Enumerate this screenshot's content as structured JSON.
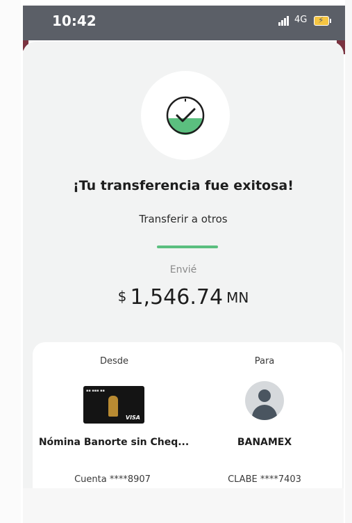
{
  "status_bar": {
    "time": "10:42",
    "network": "4G",
    "icons": [
      "signal-icon",
      "battery-charging-icon"
    ]
  },
  "colors": {
    "status_bar": "#5b5f67",
    "accent_green": "#5bbf7f",
    "card_background": "#f2f3f3",
    "maroon_header": "#7a3340"
  },
  "result": {
    "icon": "checkmark-circle-icon",
    "title": "¡Tu transferencia fue exitosa!",
    "subtitle": "Transferir a otros"
  },
  "amount": {
    "label": "Envié",
    "currency_symbol": "$",
    "value": "1,546.74",
    "unit": "MN"
  },
  "details": {
    "from": {
      "label": "Desde",
      "account_name": "Nómina Banorte sin Cheq...",
      "account_number": "Cuenta ****8907",
      "card_brand": "VISA"
    },
    "to": {
      "label": "Para",
      "account_name": "BANAMEX",
      "account_number": "CLABE ****7403",
      "icon": "user-avatar-icon"
    }
  }
}
